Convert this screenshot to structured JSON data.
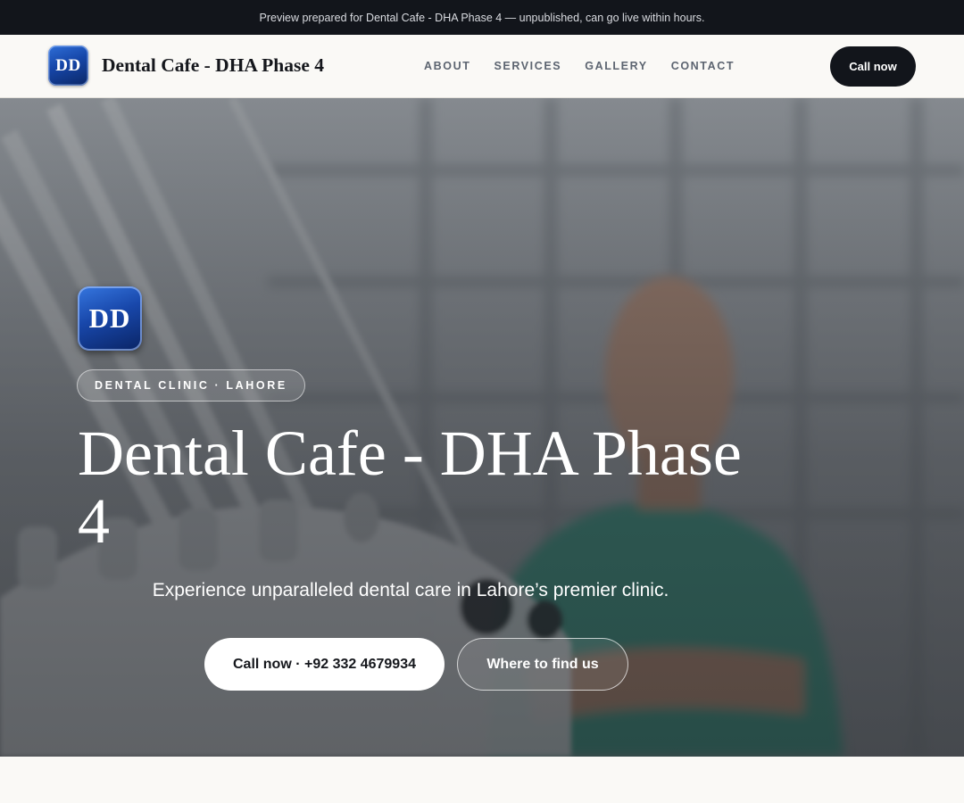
{
  "preview_bar": {
    "text": "Preview prepared for Dental Cafe - DHA Phase 4 — unpublished, can go live within hours."
  },
  "header": {
    "logo_initials": "DD",
    "brand_name": "Dental Cafe - DHA Phase 4",
    "nav": [
      {
        "label": "ABOUT"
      },
      {
        "label": "SERVICES"
      },
      {
        "label": "GALLERY"
      },
      {
        "label": "CONTACT"
      }
    ],
    "cta_label": "Call now"
  },
  "hero": {
    "logo_initials": "DD",
    "eyebrow": "DENTAL CLINIC · LAHORE",
    "title": "Dental Cafe - DHA Phase 4",
    "subtitle": "Experience unparalleled dental care in Lahore’s premier clinic.",
    "primary_button": "Call now · +92 332 4679934",
    "secondary_button": "Where to find us"
  },
  "colors": {
    "top_bar_bg": "#12151b",
    "page_bg": "#faf9f6",
    "logo_blue": "#1646a8",
    "scrubs_teal": "#3f9a86"
  },
  "icons": {
    "hero_image": "dentist-with-dental-chair-photo"
  }
}
